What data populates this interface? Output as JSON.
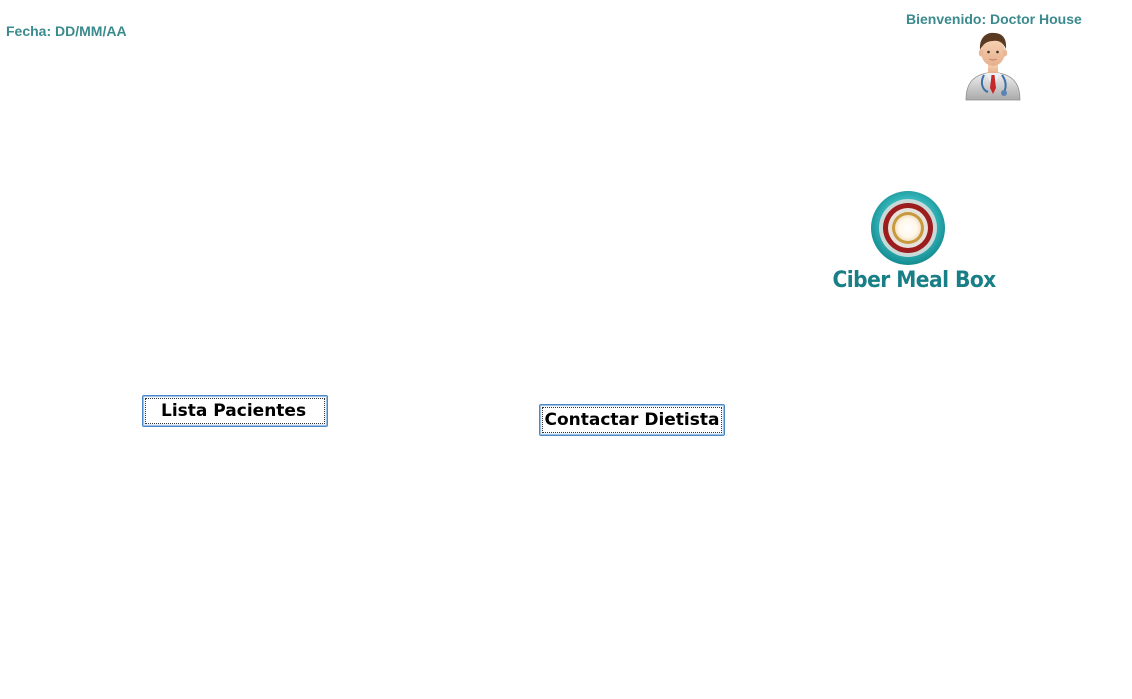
{
  "header": {
    "date_label": "Fecha: DD/MM/AA",
    "welcome_text": "Bienvenido: Doctor House"
  },
  "brand": {
    "name": "Ciber Meal Box",
    "color": "#187f86"
  },
  "actions": {
    "patients_button_label": "Lista Pacientes",
    "dietitian_button_label": "Contactar Dietista"
  },
  "icons": {
    "avatar": "doctor-avatar-icon",
    "logo": "ciber-meal-box-logo"
  }
}
